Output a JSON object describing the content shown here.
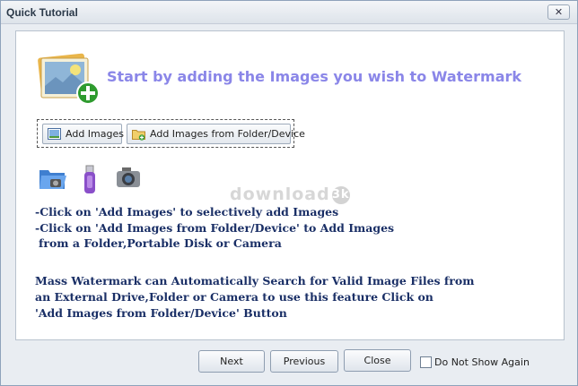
{
  "window": {
    "title": "Quick Tutorial",
    "close_glyph": "✕"
  },
  "hero": {
    "icon": "add-image-icon",
    "headline": "Start by adding the Images you wish to Watermark"
  },
  "toolbar": {
    "add_images_label": "Add Images",
    "add_folder_label": "Add Images from Folder/Device"
  },
  "devices": [
    "folder-icon",
    "usb-drive-icon",
    "camera-icon"
  ],
  "watermark_text": "download",
  "watermark_badge": "3k",
  "instructions": {
    "line1": "-Click on 'Add Images' to selectively add Images",
    "line2": "-Click on 'Add Images from Folder/Device' to Add Images",
    "line3": "from a Folder,Portable Disk or Camera",
    "para1": "Mass Watermark can Automatically Search for Valid Image Files from",
    "para2": "an External Drive,Folder or Camera to use this feature Click on",
    "para3": "'Add Images from Folder/Device' Button"
  },
  "footer": {
    "next_label": "Next",
    "previous_label": "Previous",
    "close_label": "Close",
    "checkbox_label": "Do Not Show Again",
    "checkbox_checked": false
  }
}
